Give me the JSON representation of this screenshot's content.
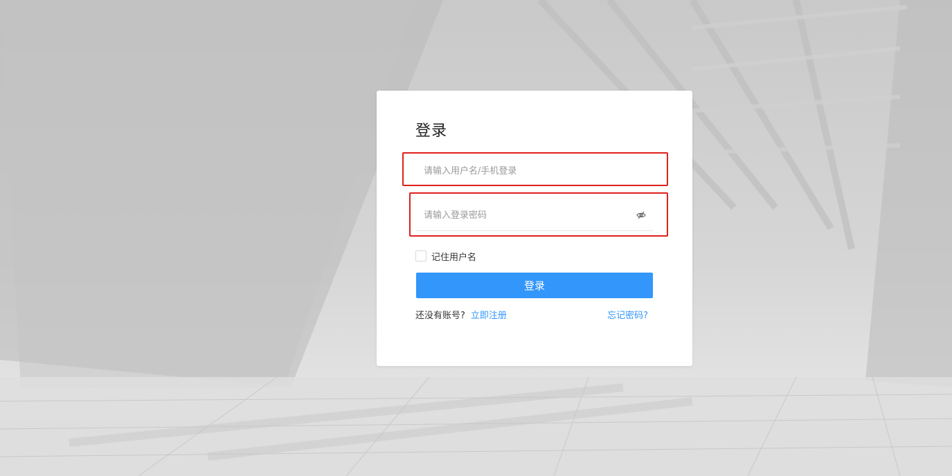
{
  "login": {
    "title": "登录",
    "username_placeholder": "请输入用户名/手机登录",
    "password_placeholder": "请输入登录密码",
    "remember_label": "记住用户名",
    "submit_label": "登录",
    "no_account_text": "还没有账号?",
    "register_link": "立即注册",
    "forgot_link": "忘记密码?"
  },
  "icons": {
    "password_toggle": "eye-slash-icon"
  },
  "colors": {
    "primary": "#3296fa",
    "highlight": "#e0201b"
  }
}
